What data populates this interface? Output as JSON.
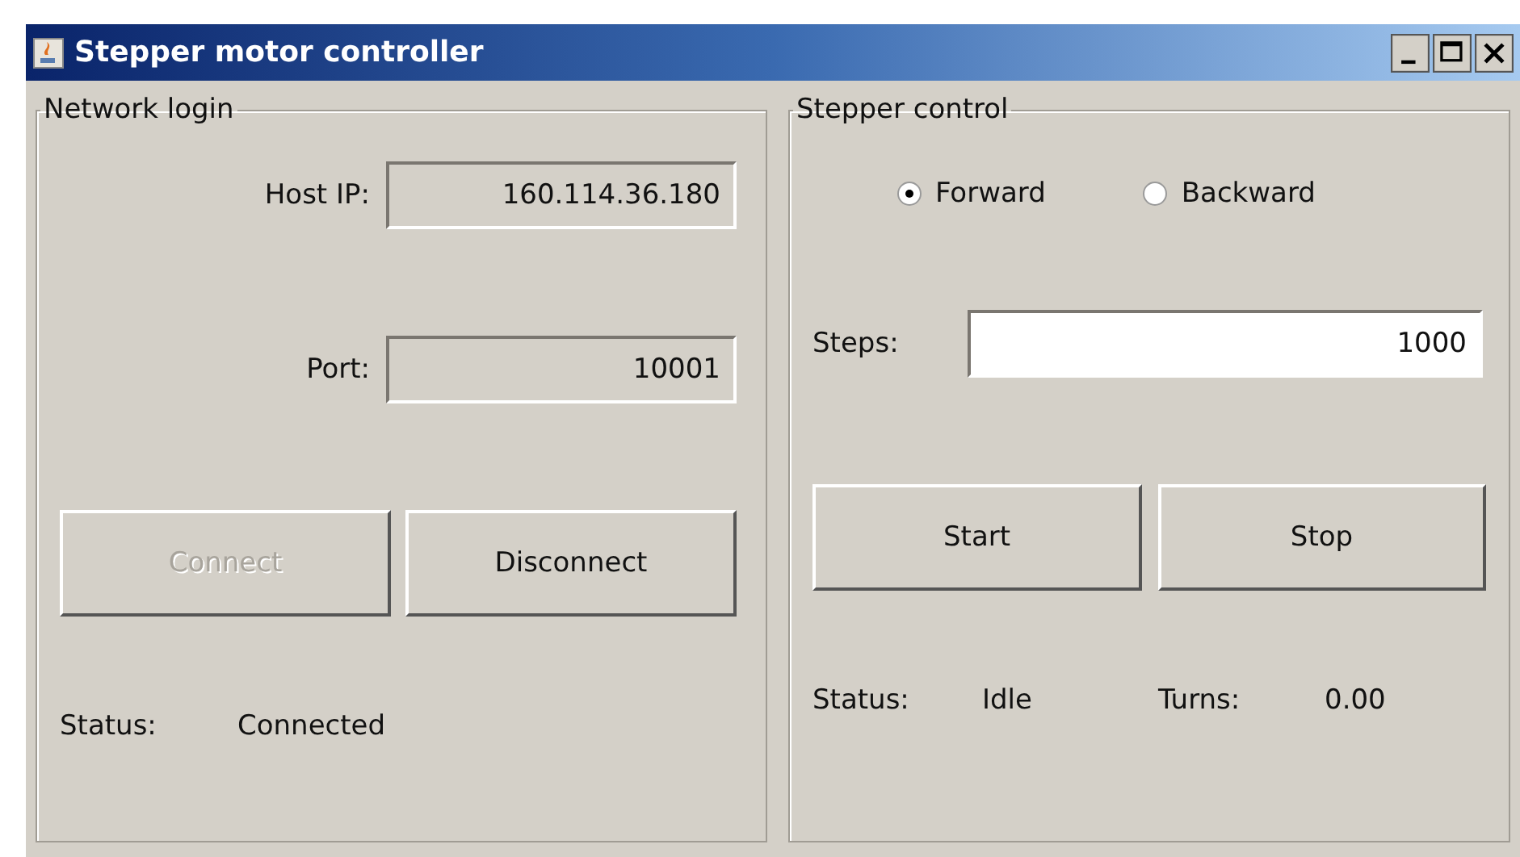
{
  "window": {
    "title": "Stepper motor controller"
  },
  "network_login": {
    "title": "Network login",
    "fields": [
      {
        "label": "Host IP:",
        "value": "160.114.36.180",
        "disabled": true
      },
      {
        "label": "Port:",
        "value": "10001",
        "disabled": true
      }
    ],
    "buttons": [
      {
        "label": "Connect",
        "disabled": true
      },
      {
        "label": "Disconnect",
        "disabled": false
      }
    ],
    "status": {
      "label": "Status:",
      "value": "Connected"
    }
  },
  "stepper_control": {
    "title": "Stepper control",
    "directions": [
      {
        "label": "Forward",
        "selected": true
      },
      {
        "label": "Backward",
        "selected": false
      }
    ],
    "steps": {
      "label": "Steps:",
      "value": "1000",
      "disabled": false
    },
    "buttons": [
      {
        "label": "Start",
        "disabled": false
      },
      {
        "label": "Stop",
        "disabled": false
      }
    ],
    "status": {
      "label": "Status:",
      "value": "Idle"
    },
    "turns": {
      "label": "Turns:",
      "value": "0.00"
    }
  }
}
